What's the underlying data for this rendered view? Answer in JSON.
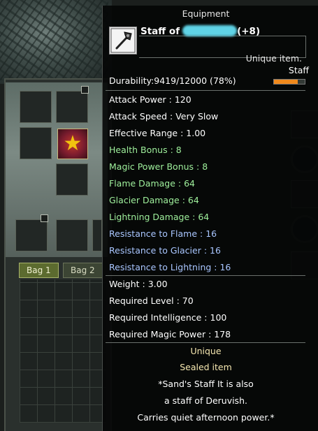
{
  "tooltip": {
    "header": "Equipment",
    "item_name_prefix": "Staff of",
    "item_name_suffix": "(+8)",
    "rarity": "Unique item.",
    "item_type": "Staff",
    "durability_text": "Durability:9419/12000 (78%)",
    "durability_fraction": 0.78,
    "base_stats": [
      "Attack Power : 120",
      "Attack Speed : Very Slow",
      "Effective Range : 1.00"
    ],
    "bonus_stats": [
      "Health Bonus : 8",
      "Magic Power Bonus : 8",
      "Flame Damage : 64",
      "Glacier Damage : 64",
      "Lightning Damage : 64"
    ],
    "resist_stats": [
      "Resistance to Flame : 16",
      "Resistance to Glacier : 16",
      "Resistance to Lightning : 16"
    ],
    "requirements": [
      "Weight : 3.00",
      "Required Level : 70",
      "Required Intelligence : 100",
      "Required Magic Power : 178"
    ],
    "footer": [
      "Unique",
      "Sealed item",
      "*Sand's Staff It is also",
      "a staff of Deruvish.",
      "Carries quiet afternoon power.*"
    ]
  },
  "inventory": {
    "tabs": [
      "Bag 1",
      "Bag 2"
    ]
  },
  "colors": {
    "bonus": "#9ff09c",
    "resist": "#a9c6ff",
    "footer": "#f5e7b0",
    "durability_bar": "#f08a1c"
  },
  "icons": {
    "item": "staff-icon",
    "inventory_item": "star-icon"
  }
}
